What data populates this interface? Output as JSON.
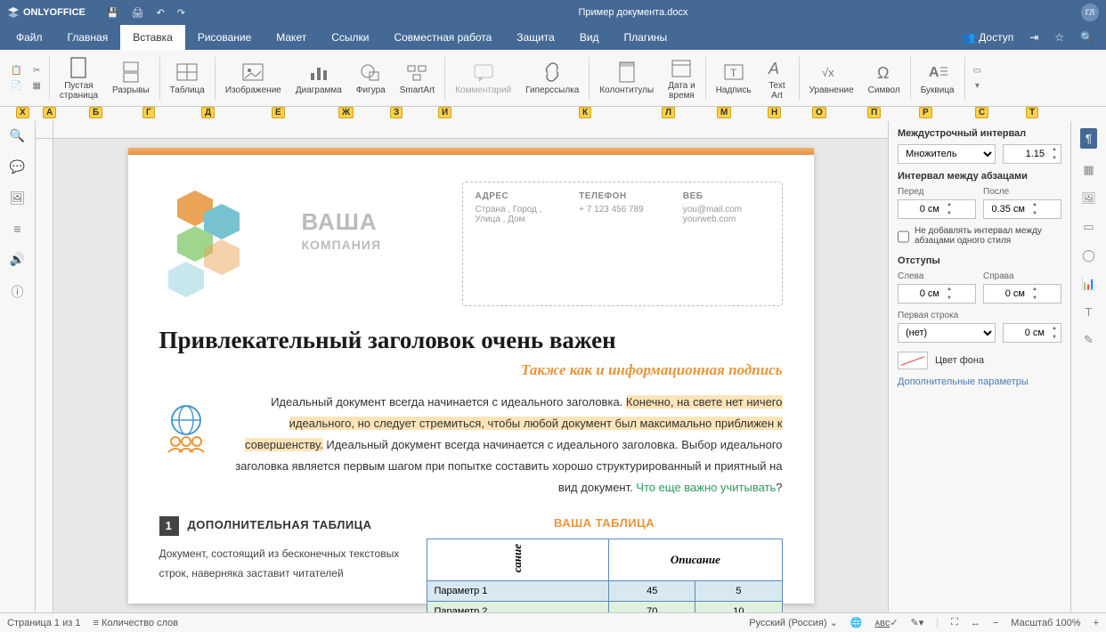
{
  "app": {
    "name": "ONLYOFFICE",
    "docTitle": "Пример документа.docx",
    "avatar": "ГЛ"
  },
  "menu": {
    "items": [
      "Файл",
      "Главная",
      "Вставка",
      "Рисование",
      "Макет",
      "Ссылки",
      "Совместная работа",
      "Защита",
      "Вид",
      "Плагины"
    ],
    "active": 2,
    "share": "Доступ"
  },
  "ribbon": {
    "blankPage": "Пустая\nстраница",
    "breaks": "Разрывы",
    "table": "Таблица",
    "image": "Изображение",
    "chart": "Диаграмма",
    "shape": "Фигура",
    "smartart": "SmartArt",
    "comment": "Комментарий",
    "hyperlink": "Гиперссылка",
    "headers": "Колонтитулы",
    "datetime": "Дата и\nвремя",
    "textbox": "Надпись",
    "textart": "Text\nArt",
    "equation": "Уравнение",
    "symbol": "Символ",
    "dropcap": "Буквица"
  },
  "keyhints": [
    "Х",
    "А",
    "Б",
    "Г",
    "Д",
    "Е",
    "Ж",
    "З",
    "И",
    "К",
    "Л",
    "М",
    "Н",
    "О",
    "П",
    "Р",
    "С",
    "Т"
  ],
  "document": {
    "company": {
      "name": "ВАША",
      "sub": "КОМПАНИЯ"
    },
    "contact": {
      "addressLabel": "АДРЕС",
      "address1": "Страна , Город ,",
      "address2": "Улица , Дом",
      "phoneLabel": "ТЕЛЕФОН",
      "phone": "+ 7 123 456 789",
      "webLabel": "ВЕБ",
      "email": "you@mail.com",
      "web": "yourweb.com"
    },
    "h1": "Привлекательный заголовок очень важен",
    "h2": "Также как и информационная подпись",
    "p1a": "Идеальный документ всегда начинается с идеального заголовка. ",
    "p1hl": "Конечно, на свете нет ничего идеального, но следует стремиться, чтобы любой документ был максимально приближен к совершенству.",
    "p1b": " Идеальный документ всегда начинается с идеального заголовка. Выбор идеального заголовка является первым шагом при попытке составить хорошо структурированный и приятный на вид документ. ",
    "p1link": "Что еще важно учитывать",
    "p1q": "?",
    "leftNum": "1",
    "leftHead": "ДОПОЛНИТЕЛЬНАЯ ТАБЛИЦА",
    "leftText": "Документ, состоящий из бесконечных текстовых строк, наверняка заставит читателей",
    "tableTitle": "ВАША ТАБЛИЦА",
    "tableHead": "Описание",
    "tableSide": "сание",
    "tableRows": [
      {
        "p": "Параметр 1",
        "a": "45",
        "b": "5"
      },
      {
        "p": "Параметр 2",
        "a": "70",
        "b": "10"
      }
    ]
  },
  "panel": {
    "lineSpacingTitle": "Междустрочный интервал",
    "lineSpacingMode": "Множитель",
    "lineSpacingVal": "1.15",
    "paraSpacingTitle": "Интервал между абзацами",
    "beforeLabel": "Перед",
    "beforeVal": "0 см",
    "afterLabel": "После",
    "afterVal": "0.35 см",
    "noSpaceSameStyle": "Не добавлять интервал между абзацами одного стиля",
    "indentsTitle": "Отступы",
    "leftLabel": "Слева",
    "leftVal": "0 см",
    "rightLabel": "Справа",
    "rightVal": "0 см",
    "firstLineLabel": "Первая строка",
    "firstLineMode": "(нет)",
    "firstLineVal": "0 см",
    "bgColor": "Цвет фона",
    "advanced": "Дополнительные параметры"
  },
  "status": {
    "page": "Страница 1 из 1",
    "words": "Количество слов",
    "lang": "Русский (Россия)",
    "zoom": "Масштаб 100%"
  }
}
